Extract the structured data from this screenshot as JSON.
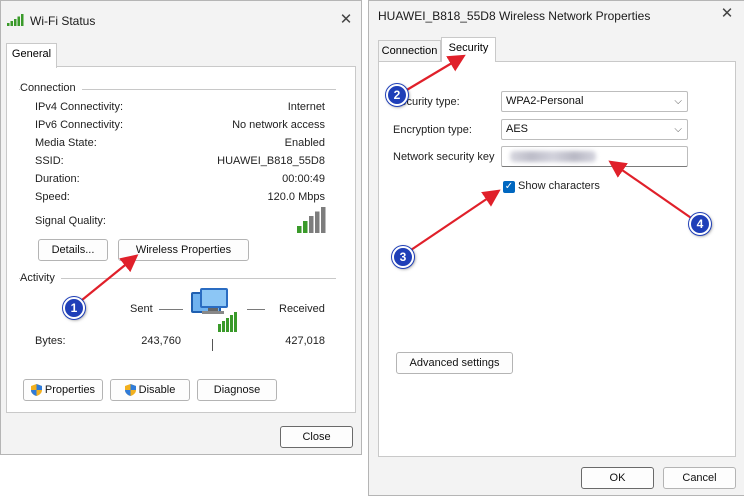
{
  "left_window": {
    "title": "Wi-Fi Status",
    "tab": "General",
    "connection": {
      "group_label": "Connection",
      "rows": [
        {
          "label": "IPv4 Connectivity:",
          "value": "Internet"
        },
        {
          "label": "IPv6 Connectivity:",
          "value": "No network access"
        },
        {
          "label": "Media State:",
          "value": "Enabled"
        },
        {
          "label": "SSID:",
          "value": "HUAWEI_B818_55D8"
        },
        {
          "label": "Duration:",
          "value": "00:00:49"
        },
        {
          "label": "Speed:",
          "value": "120.0 Mbps"
        }
      ],
      "signal_label": "Signal Quality:",
      "signal_bars": 5,
      "details_button": "Details...",
      "wireless_properties_button": "Wireless Properties"
    },
    "activity": {
      "group_label": "Activity",
      "sent_label": "Sent",
      "received_label": "Received",
      "bytes_label": "Bytes:",
      "bytes_sent": "243,760",
      "bytes_received": "427,018"
    },
    "buttons": {
      "properties": "Properties",
      "disable": "Disable",
      "diagnose": "Diagnose",
      "close": "Close"
    }
  },
  "right_window": {
    "title": "HUAWEI_B818_55D8 Wireless Network Properties",
    "tabs": [
      "Connection",
      "Security"
    ],
    "active_tab": "Security",
    "security_type_label": "Security type:",
    "security_type_value": "WPA2-Personal",
    "encryption_type_label": "Encryption type:",
    "encryption_type_value": "AES",
    "network_key_label": "Network security key",
    "show_characters_label": "Show characters",
    "show_characters_checked": true,
    "advanced_button": "Advanced settings",
    "ok_button": "OK",
    "cancel_button": "Cancel"
  },
  "annotations": {
    "badges": [
      "1",
      "2",
      "3",
      "4"
    ],
    "arrow_color": "#e0202a",
    "badge_color": "#1f3fb8"
  }
}
